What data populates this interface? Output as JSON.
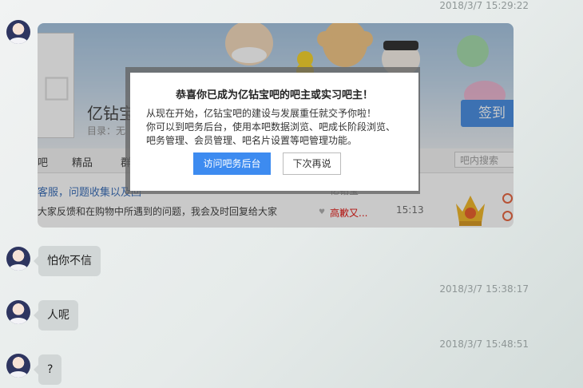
{
  "timestamps": [
    "2018/3/7 15:29:22",
    "2018/3/7 15:38:17",
    "2018/3/7 15:48:51"
  ],
  "messages": [
    {
      "text": "怕你不信"
    },
    {
      "text": "人呢"
    },
    {
      "text": "?"
    }
  ],
  "card": {
    "forum_title": "亿钻宝",
    "directory_label": "目录：",
    "directory_value": "无",
    "sign_button": "签到",
    "nav_items": [
      "吧",
      "精品",
      "群"
    ],
    "search_placeholder": "吧内搜索",
    "thread1": "客服，问题收集以及回",
    "thread2": "大家反馈和在购物中所遇到的问题，我会及时回复给大家",
    "author1": "亿钻宝",
    "author2": "高歉又...",
    "time2": "15:13",
    "side_marks": [
      "口",
      "口"
    ]
  },
  "dialog": {
    "title": "恭喜你已成为亿钻宝吧的吧主或实习吧主！",
    "body": [
      "从现在开始，亿钻宝吧的建设与发展重任就交予你啦！",
      "你可以到吧务后台，使用本吧数据浏览、吧成长阶段浏览、",
      "吧务管理、会员管理、吧名片设置等吧管理功能。"
    ],
    "primary_button": "访问吧务后台",
    "secondary_button": "下次再说"
  },
  "colors": {
    "primary_blue": "#3d8bf0",
    "sign_blue": "#3c86e0",
    "link_blue": "#2d64b3",
    "author_red": "#e10601"
  }
}
